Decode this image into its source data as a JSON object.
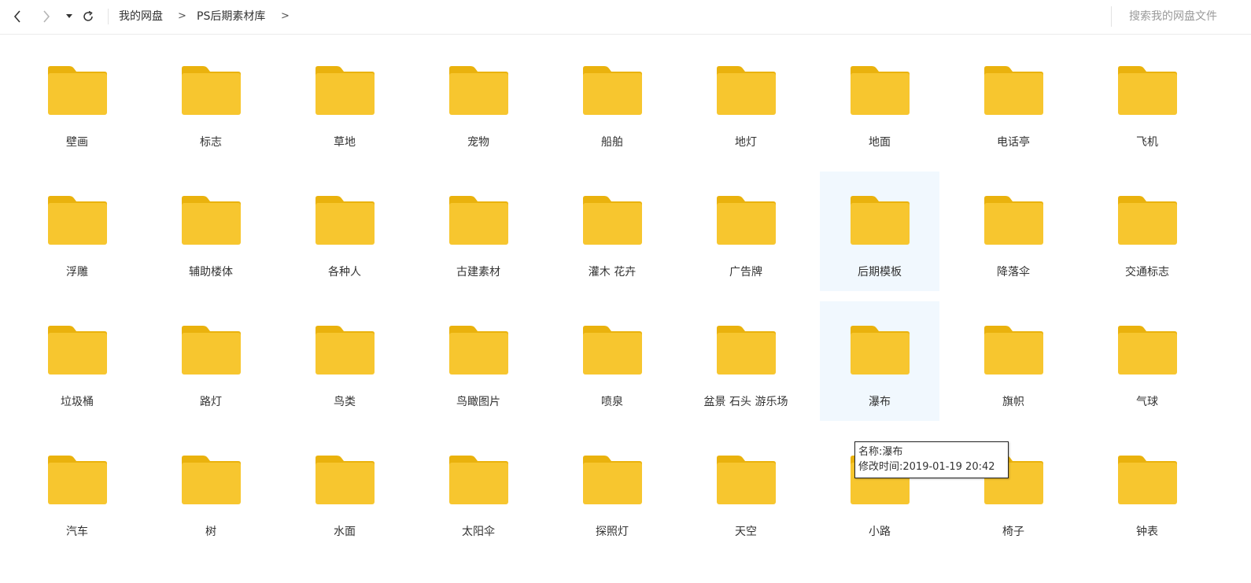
{
  "toolbar": {
    "back_icon": "chevron-left-icon",
    "forward_icon": "chevron-right-icon",
    "history_icon": "caret-down-icon",
    "refresh_icon": "refresh-icon",
    "breadcrumbs": [
      "我的网盘",
      "PS后期素材库"
    ],
    "separator": ">"
  },
  "search": {
    "placeholder": "搜索我的网盘文件"
  },
  "folders": [
    {
      "name": "壁画"
    },
    {
      "name": "标志"
    },
    {
      "name": "草地"
    },
    {
      "name": "宠物"
    },
    {
      "name": "船舶"
    },
    {
      "name": "地灯"
    },
    {
      "name": "地面"
    },
    {
      "name": "电话亭"
    },
    {
      "name": "飞机"
    },
    {
      "name": "浮雕"
    },
    {
      "name": "辅助楼体"
    },
    {
      "name": "各种人"
    },
    {
      "name": "古建素材"
    },
    {
      "name": "灌木 花卉"
    },
    {
      "name": "广告牌"
    },
    {
      "name": "后期模板"
    },
    {
      "name": "降落伞"
    },
    {
      "name": "交通标志"
    },
    {
      "name": "垃圾桶"
    },
    {
      "name": "路灯"
    },
    {
      "name": "鸟类"
    },
    {
      "name": "鸟瞰图片"
    },
    {
      "name": "喷泉"
    },
    {
      "name": "盆景 石头 游乐场"
    },
    {
      "name": "瀑布"
    },
    {
      "name": "旗帜"
    },
    {
      "name": "气球"
    },
    {
      "name": "汽车"
    },
    {
      "name": "树"
    },
    {
      "name": "水面"
    },
    {
      "name": "太阳伞"
    },
    {
      "name": "探照灯"
    },
    {
      "name": "天空"
    },
    {
      "name": "小路"
    },
    {
      "name": "椅子"
    },
    {
      "name": "钟表"
    }
  ],
  "folder_icon": "folder-icon",
  "folder_color": "#f7c62f",
  "folder_tab_color": "#eab20d",
  "hover_bg_color": "#f1f8fe",
  "tooltip": {
    "name_line": "名称:瀑布",
    "time_line": "修改时间:2019-01-19 20:42"
  }
}
